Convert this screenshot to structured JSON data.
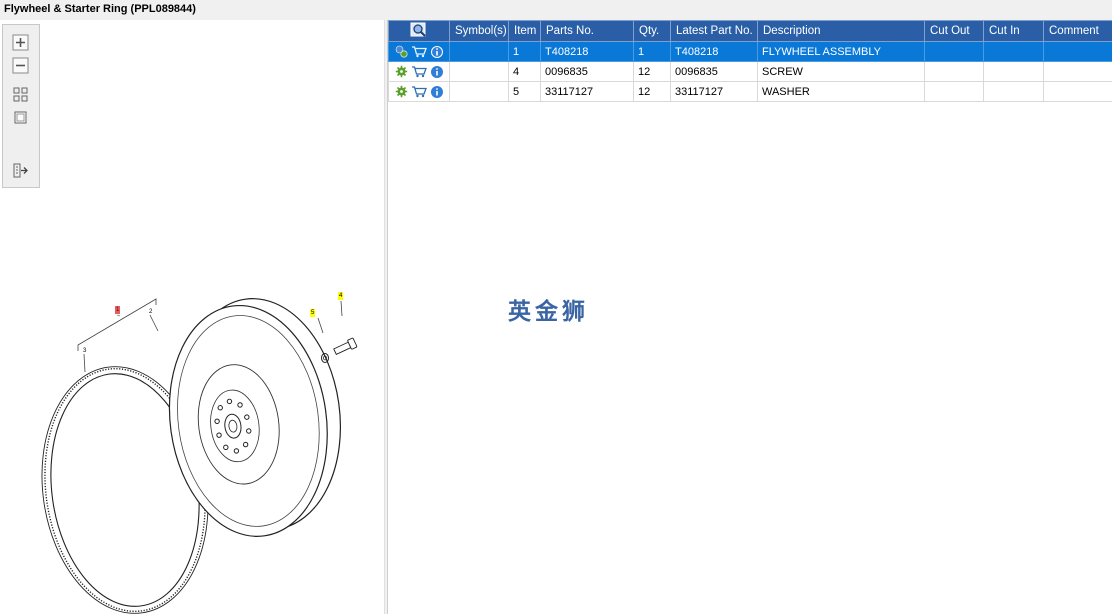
{
  "window": {
    "title": "Flywheel & Starter Ring (PPL089844)"
  },
  "toolbar": {
    "zoom_in": "zoom-in",
    "zoom_out": "zoom-out",
    "fit_all": "fit-all",
    "fit_page": "fit-page",
    "export": "export"
  },
  "drawing": {
    "callouts": [
      "1",
      "2",
      "3",
      "4",
      "5"
    ],
    "highlight_colors": {
      "selected": "#e06060",
      "hotspot": "#ffff00"
    }
  },
  "table": {
    "columns": [
      "",
      "Symbol(s)",
      "Item",
      "Parts No.",
      "Qty.",
      "Latest Part No.",
      "Description",
      "Cut Out",
      "Cut In",
      "Comment"
    ],
    "rows": [
      {
        "symbols": "",
        "item": "1",
        "parts_no": "T408218",
        "qty": "1",
        "latest": "T408218",
        "desc": "FLYWHEEL ASSEMBLY",
        "cut_out": "",
        "cut_in": "",
        "comment": ""
      },
      {
        "symbols": "",
        "item": "4",
        "parts_no": "0096835",
        "qty": "12",
        "latest": "0096835",
        "desc": "SCREW",
        "cut_out": "",
        "cut_in": "",
        "comment": ""
      },
      {
        "symbols": "",
        "item": "5",
        "parts_no": "33117127",
        "qty": "12",
        "latest": "33117127",
        "desc": "WASHER",
        "cut_out": "",
        "cut_in": "",
        "comment": ""
      }
    ],
    "selected_row": 0
  },
  "watermark": "英金狮",
  "colors": {
    "header": "#2a5fa8",
    "selection": "#0a78d7",
    "watermark": "#3a64a4"
  }
}
